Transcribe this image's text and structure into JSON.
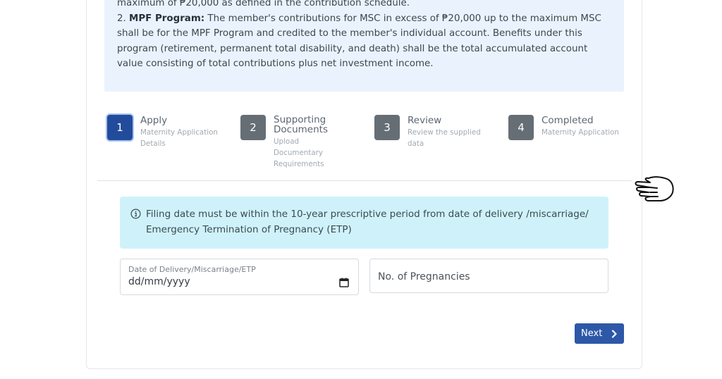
{
  "info": {
    "line1": "maximum of ₱20,000 as defined in the contribution schedule.",
    "mpf_prefix": "2. ",
    "mpf_title": "MPF Program:",
    "mpf_body": " The member's contributions for MSC in excess of ₱20,000 up to the maximum MSC shall be for the MPF Program and credited to the member's individual account. Benefits under this program (retirement, permanent total disability, and death) shall be the total accumulated account value consisting of total contributions plus net investment income."
  },
  "steps": [
    {
      "number": "1",
      "title": "Apply",
      "subtitle": "Maternity Application Details",
      "active": true
    },
    {
      "number": "2",
      "title": "Supporting Documents",
      "subtitle": "Upload Documentary Requirements",
      "active": false
    },
    {
      "number": "3",
      "title": "Review",
      "subtitle": "Review the supplied data",
      "active": false
    },
    {
      "number": "4",
      "title": "Completed",
      "subtitle": "Maternity Application",
      "active": false
    }
  ],
  "alert": {
    "icon": "info-circle-icon",
    "text": "Filing date must be within the 10-year prescriptive period from date of delivery /miscarriage/ Emergency Termination of Pregnancy (ETP)"
  },
  "form": {
    "delivery_date": {
      "label": "Date of Delivery/Miscarriage/ETP",
      "value": "dd/mm/yyyy",
      "icon": "calendar-icon"
    },
    "pregnancies": {
      "placeholder": "No. of Pregnancies"
    }
  },
  "actions": {
    "next_label": "Next",
    "next_icon": "chevron-right-icon"
  },
  "cursor": {
    "icon": "hand-pointer-icon"
  },
  "colors": {
    "accent": "#2d58a8",
    "active_step": "#224c9b",
    "inactive_step": "#666e75",
    "info_panel": "#eaf3fd",
    "alert_bg": "#cff2fa"
  }
}
